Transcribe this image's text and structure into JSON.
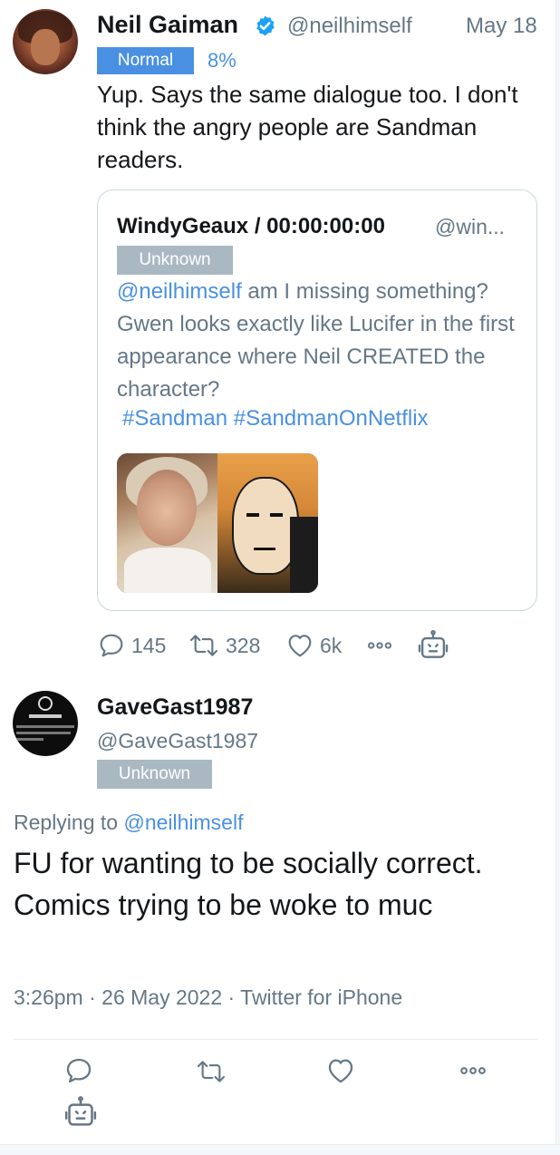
{
  "tweet": {
    "author_name": "Neil Gaiman",
    "author_handle": "@neilhimself",
    "date": "May 18",
    "badge": "Normal",
    "percent": "8%",
    "text": "Yup. Says the same dialogue too. I don't think the angry people are Sandman readers.",
    "quote": {
      "author_name": "WindyGeaux / 00:00:00:00",
      "author_handle": "@win...",
      "badge": "Unknown",
      "mention": "@neilhimself",
      "text": " am I missing something? Gwen looks exactly like Lucifer in the first appearance where Neil CREATED the character?",
      "hashtags": "#Sandman #SandmanOnNetflix"
    },
    "actions": {
      "replies": "145",
      "retweets": "328",
      "likes": "6k"
    }
  },
  "reply": {
    "author_name": "GaveGast1987",
    "author_handle": "@GaveGast1987",
    "badge": "Unknown",
    "replying_prefix": "Replying to ",
    "replying_to": "@neilhimself",
    "text": "FU for wanting to be socially correct. Comics trying to be woke to muc",
    "meta": "3:26pm · 26 May 2022 · Twitter for iPhone"
  },
  "colors": {
    "link": "#4a90e2",
    "muted": "#657786",
    "badge_normal": "#4a90e2",
    "badge_unknown": "#aab8c2"
  }
}
